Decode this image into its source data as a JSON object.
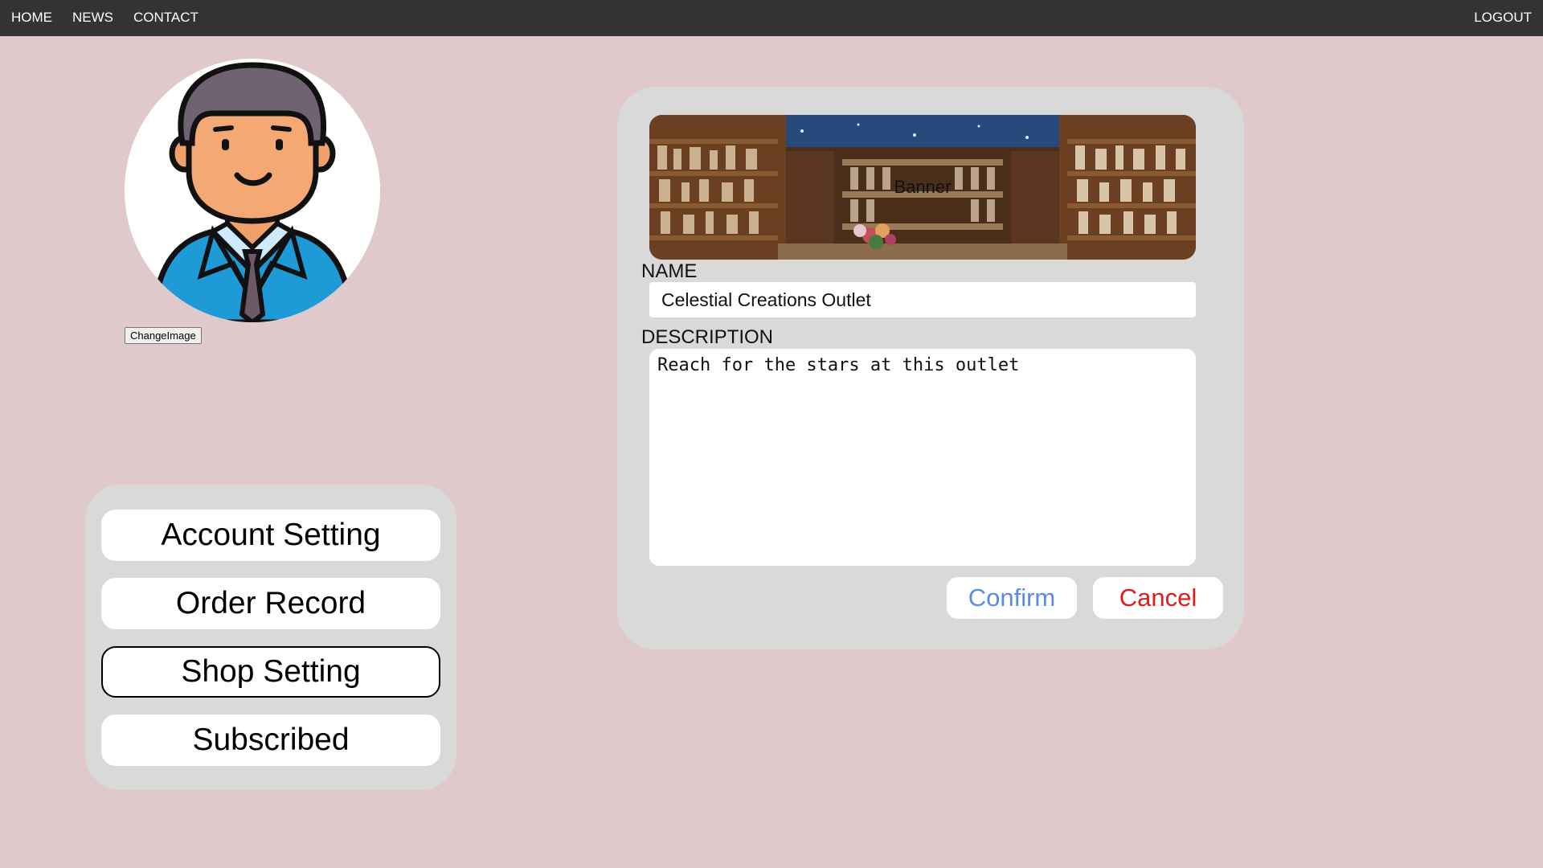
{
  "nav": {
    "home": "HOME",
    "news": "NEWS",
    "contact": "CONTACT",
    "logout": "LOGOUT"
  },
  "profile": {
    "avatar_icon": "businessman-avatar-icon",
    "change_image_label": "ChangeImage"
  },
  "menu": {
    "items": [
      {
        "label": "Account Setting",
        "active": false
      },
      {
        "label": "Order Record",
        "active": false
      },
      {
        "label": "Shop Setting",
        "active": true
      },
      {
        "label": "Subscribed",
        "active": false
      }
    ]
  },
  "shop_form": {
    "banner_alt": "Banner",
    "name_label": "NAME",
    "name_value": "Celestial Creations Outlet",
    "description_label": "DESCRIPTION",
    "description_value": "Reach for the stars at this outlet",
    "confirm_label": "Confirm",
    "cancel_label": "Cancel"
  },
  "colors": {
    "page_background": "#dfc9cb",
    "nav_background": "#333333",
    "panel_background": "#d9d9d9",
    "confirm_text": "#5b8be6",
    "cancel_text": "#e21a1a"
  }
}
